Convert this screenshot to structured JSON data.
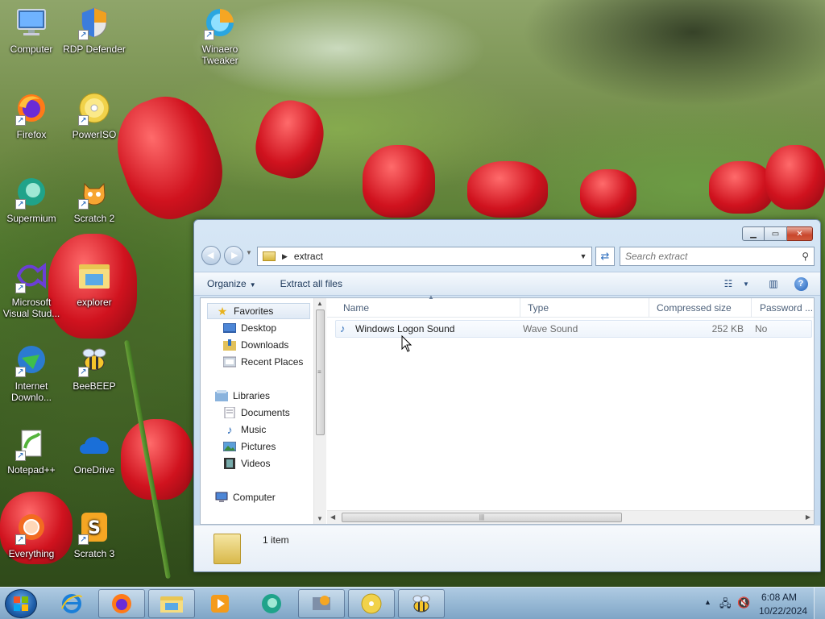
{
  "desktop": {
    "icons": [
      {
        "label": "Computer",
        "icon": "computer-icon"
      },
      {
        "label": "RDP Defender",
        "icon": "shield-icon"
      },
      {
        "label": "Winaero Tweaker",
        "icon": "winaero-icon"
      },
      {
        "label": "Firefox",
        "icon": "firefox-icon"
      },
      {
        "label": "PowerISO",
        "icon": "disc-icon"
      },
      {
        "label": "Supermium",
        "icon": "supermium-icon"
      },
      {
        "label": "Scratch 2",
        "icon": "scratch-cat-icon"
      },
      {
        "label": "Microsoft Visual Stud...",
        "icon": "visual-studio-icon"
      },
      {
        "label": "explorer",
        "icon": "folder-icon"
      },
      {
        "label": "Internet Downlo...",
        "icon": "idm-icon"
      },
      {
        "label": "BeeBEEP",
        "icon": "bee-icon"
      },
      {
        "label": "Notepad++",
        "icon": "notepad-icon"
      },
      {
        "label": "OneDrive",
        "icon": "cloud-icon"
      },
      {
        "label": "Everything",
        "icon": "search-ring-icon"
      },
      {
        "label": "Scratch 3",
        "icon": "scratch-s-icon"
      }
    ]
  },
  "window": {
    "address": {
      "path": "extract"
    },
    "search": {
      "placeholder": "Search extract"
    },
    "toolbar": {
      "organize": "Organize",
      "extract_all": "Extract all files"
    },
    "nav": {
      "favorites": "Favorites",
      "desktop": "Desktop",
      "downloads": "Downloads",
      "recent": "Recent Places",
      "libraries": "Libraries",
      "documents": "Documents",
      "music": "Music",
      "pictures": "Pictures",
      "videos": "Videos",
      "computer": "Computer"
    },
    "columns": [
      "Name",
      "Type",
      "Compressed size",
      "Password ..."
    ],
    "files": [
      {
        "name": "Windows Logon Sound",
        "type": "Wave Sound",
        "size": "252 KB",
        "password": "No"
      }
    ],
    "status": {
      "count": "1 item"
    }
  },
  "taskbar": {
    "items": [
      "internet-explorer-icon",
      "firefox-icon",
      "explorer-icon",
      "media-player-icon",
      "supermium-icon",
      "winaero-icon",
      "poweriso-icon",
      "beebeep-icon"
    ],
    "clock": {
      "time": "6:08 AM",
      "date": "10/22/2024"
    }
  },
  "colors": {
    "accent": "#1e5da8",
    "window_frame": "#c2d8ee",
    "close_red": "#c9462c"
  }
}
